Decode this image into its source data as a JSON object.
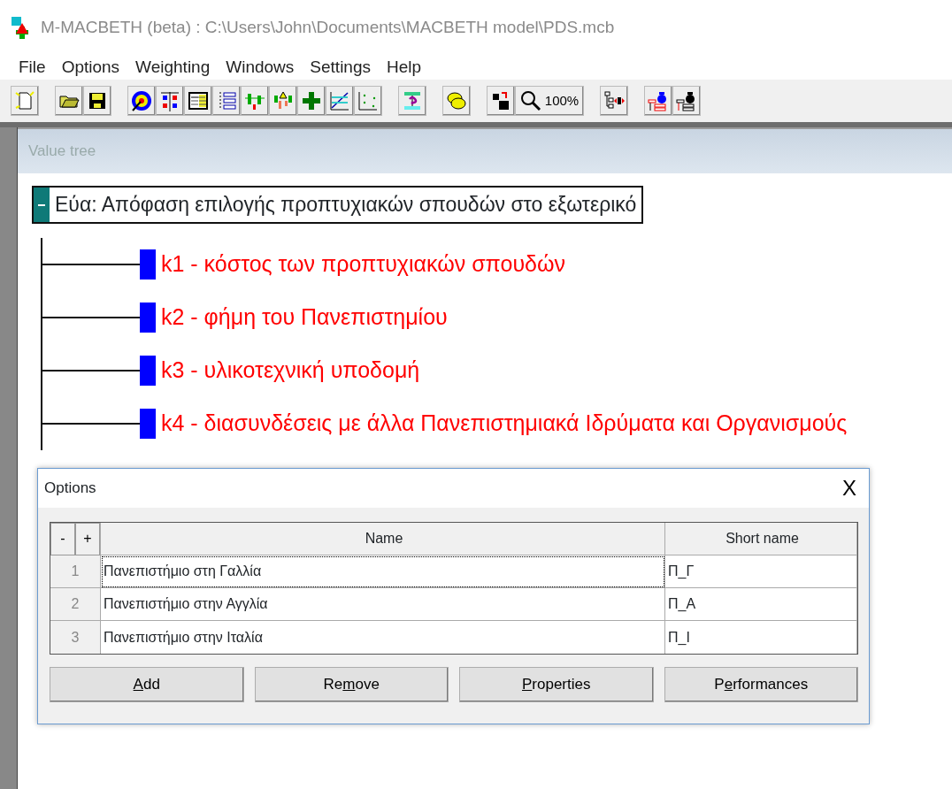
{
  "window": {
    "title": "M-MACBETH (beta) : C:\\Users\\John\\Documents\\MACBETH model\\PDS.mcb"
  },
  "menu": [
    "File",
    "Options",
    "Weighting",
    "Windows",
    "Settings",
    "Help"
  ],
  "toolbar": {
    "zoom_label": "100%"
  },
  "value_tree": {
    "title": "Value tree",
    "root": {
      "label": "Εύα: Απόφαση επιλογής προπτυχιακών σπουδών στο εξωτερικό",
      "expanded": true,
      "children": [
        {
          "label": "k1 - κόστος των προπτυχιακών σπουδών"
        },
        {
          "label": "k2 - φήμη του Πανεπιστημίου"
        },
        {
          "label": "k3 - υλικοτεχνική υποδομή"
        },
        {
          "label": "k4 - διασυνδέσεις με άλλα Πανεπιστημιακά Ιδρύματα και Οργανισμούς"
        }
      ]
    }
  },
  "options_dialog": {
    "title": "Options",
    "close": "X",
    "table": {
      "row_buttons": [
        "-",
        "+"
      ],
      "columns": [
        "Name",
        "Short name"
      ],
      "rows": [
        {
          "number": "1",
          "name": "Πανεπιστήμιο στη Γαλλία",
          "short_name": "Π_Γ",
          "selected": true
        },
        {
          "number": "2",
          "name": "Πανεπιστήμιο στην Αγγλία",
          "short_name": "Π_Α",
          "selected": false
        },
        {
          "number": "3",
          "name": "Πανεπιστήμιο στην Ιταλία",
          "short_name": "Π_Ι",
          "selected": false
        }
      ]
    },
    "buttons": [
      {
        "key": "A",
        "after": "dd"
      },
      {
        "before": "Re",
        "key": "m",
        "after": "ove"
      },
      {
        "key": "P",
        "after": "roperties"
      },
      {
        "before": "P",
        "key": "e",
        "after": "rformances"
      }
    ]
  }
}
